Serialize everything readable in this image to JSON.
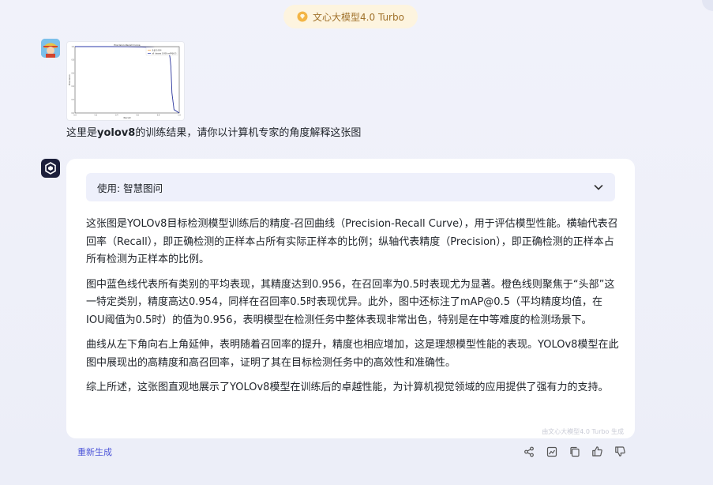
{
  "header": {
    "model_label": "文心大模型4.0 Turbo"
  },
  "user_message": {
    "text_prefix": "这里是",
    "text_bold": "yolov8",
    "text_suffix": "的训练结果，请你以计算机专家的角度解释这张图"
  },
  "attachment": {
    "chart_data": {
      "type": "line",
      "title": "Precision-Recall Curve",
      "xlabel": "Recall",
      "ylabel": "Precision",
      "xlim": [
        0,
        1
      ],
      "ylim": [
        0,
        1
      ],
      "legend": [
        "头部 0.954",
        "all classes 0.956 mAP@0.5"
      ],
      "legend_position": "top-right",
      "series": [
        {
          "name": "头部 0.954",
          "color": "#f39c3c",
          "x": [
            0,
            0.3,
            0.5,
            0.6,
            0.7,
            0.75,
            0.8,
            0.85,
            0.88,
            0.9,
            0.91,
            0.92,
            0.93,
            0.95,
            1.0
          ],
          "y": [
            1.0,
            1.0,
            0.998,
            0.995,
            0.99,
            0.985,
            0.975,
            0.96,
            0.94,
            0.9,
            0.85,
            0.7,
            0.3,
            0.05,
            0.0
          ]
        },
        {
          "name": "all classes 0.956 mAP@0.5",
          "color": "#2a3aa8",
          "x": [
            0,
            0.3,
            0.5,
            0.6,
            0.7,
            0.75,
            0.8,
            0.85,
            0.88,
            0.9,
            0.91,
            0.92,
            0.93,
            0.95,
            1.0
          ],
          "y": [
            1.0,
            1.0,
            0.998,
            0.995,
            0.99,
            0.985,
            0.975,
            0.96,
            0.94,
            0.9,
            0.85,
            0.7,
            0.3,
            0.05,
            0.0
          ]
        }
      ]
    }
  },
  "answer": {
    "tool_label": "使用: 智慧图问",
    "paragraphs": [
      "这张图是YOLOv8目标检测模型训练后的精度-召回曲线（Precision-Recall Curve），用于评估模型性能。横轴代表召回率（Recall），即正确检测的正样本占所有实际正样本的比例；纵轴代表精度（Precision），即正确检测的正样本占所有检测为正样本的比例。",
      "图中蓝色线代表所有类别的平均表现，其精度达到0.956，在召回率为0.5时表现尤为显著。橙色线则聚焦于“头部”这一特定类别，精度高达0.954，同样在召回率0.5时表现优异。此外，图中还标注了mAP@0.5（平均精度均值，在IOU阈值为0.5时）的值为0.956，表明模型在检测任务中整体表现非常出色，特别是在中等难度的检测场景下。",
      "曲线从左下角向右上角延伸，表明随着召回率的提升，精度也相应增加，这是理想模型性能的表现。YOLOv8模型在此图中展现出的高精度和高召回率，证明了其在目标检测任务中的高效性和准确性。",
      "综上所述，这张图直观地展示了YOLOv8模型在训练后的卓越性能，为计算机视觉领域的应用提供了强有力的支持。"
    ],
    "watermark": "由文心大模型4.0 Turbo 生成"
  },
  "actions": {
    "regenerate_label": "重新生成",
    "icons": [
      "share-icon",
      "image-icon",
      "copy-icon",
      "thumbs-up-icon",
      "thumbs-down-icon"
    ]
  },
  "colors": {
    "accent": "#4f57d9",
    "pill_bg": "#fdf4df",
    "pill_text": "#a0712b"
  }
}
